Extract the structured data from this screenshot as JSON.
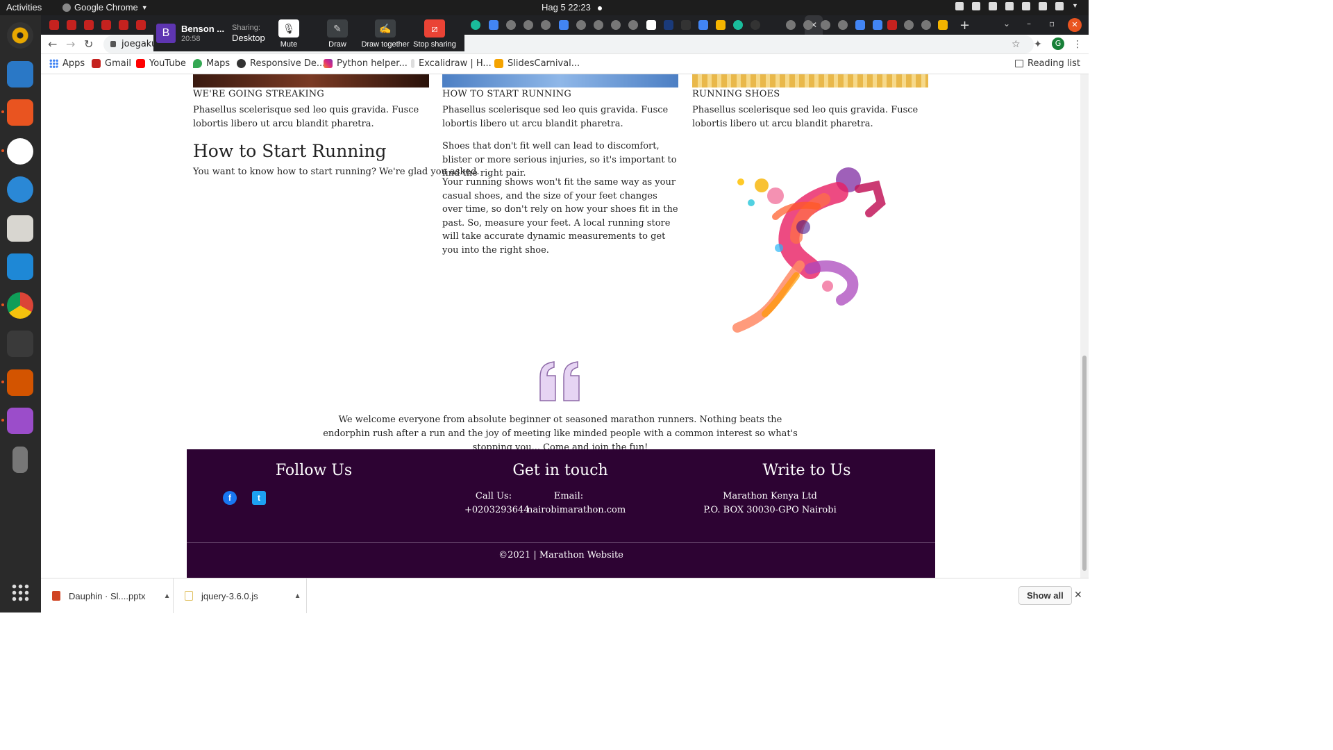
{
  "topbar": {
    "activities": "Activities",
    "app": "Google Chrome",
    "clock": "Hag 5  22:23"
  },
  "chrome": {
    "active_tab_close": "✕",
    "url": "joegakur",
    "avatar_letter": "G",
    "colors": {
      "tabstrip": "#202124",
      "accent": "#e95420"
    }
  },
  "bookmarks": {
    "apps": "Apps",
    "gmail": "Gmail",
    "youtube": "YouTube",
    "maps": "Maps",
    "responsive": "Responsive De...",
    "python": "Python helper...",
    "excalidraw": "Excalidraw | H...",
    "slides": "SlidesCarnival...",
    "reading_list": "Reading list"
  },
  "meet": {
    "avatar": "B",
    "name": "Benson ...",
    "time": "20:58",
    "sharing_label": "Sharing:",
    "sharing_value": "Desktop",
    "mute": "Mute",
    "draw": "Draw",
    "draw_together": "Draw together",
    "stop_sharing": "Stop sharing"
  },
  "cards": [
    {
      "title": "WE'RE GOING STREAKING",
      "text": "Phasellus scelerisque sed leo quis gravida. Fusce lobortis libero ut arcu blandit pharetra.",
      "color": "#5a2a1a"
    },
    {
      "title": "HOW TO START RUNNING",
      "text": "Phasellus scelerisque sed leo quis gravida. Fusce lobortis libero ut arcu blandit pharetra.",
      "color": "#6a9bd6"
    },
    {
      "title": "RUNNING SHOES",
      "text": "Phasellus scelerisque sed leo quis gravida. Fusce lobortis libero ut arcu blandit pharetra.",
      "color": "#e9b84a"
    }
  ],
  "section": {
    "heading": "How to Start Running",
    "intro": "You want to know how to start running? We're glad you asked.",
    "para1": "Shoes that don't fit well can lead to discomfort, blister or more serious injuries, so it's important to find the right pair.",
    "para2": "Your running shows won't fit the same way as your casual shoes, and the size of your feet changes over time, so don't rely on how your shoes fit in the past. So, measure your feet. A local running store will take accurate dynamic measurements to get you into the right shoe."
  },
  "quote": {
    "text": "We welcome everyone from absolute beginner ot seasoned marathon runners. Nothing beats the endorphin rush after a run and the joy of meeting like minded people with a common interest so what's stopping you... Come and join the fun!"
  },
  "footer": {
    "follow": "Follow Us",
    "touch": "Get in touch",
    "write": "Write to Us",
    "call_label": "Call Us:",
    "call_value": "+0203293644",
    "email_label": "Email:",
    "email_value": "nairobimarathon.com",
    "company": "Marathon Kenya Ltd",
    "address": "P.O. BOX 30030-GPO Nairobi",
    "copyright": "©2021 | Marathon Website",
    "colors": {
      "background": "#2d0333"
    }
  },
  "downloads": {
    "file1": "Dauphin · Sl....pptx",
    "file2": "jquery-3.6.0.js",
    "show_all": "Show all"
  }
}
